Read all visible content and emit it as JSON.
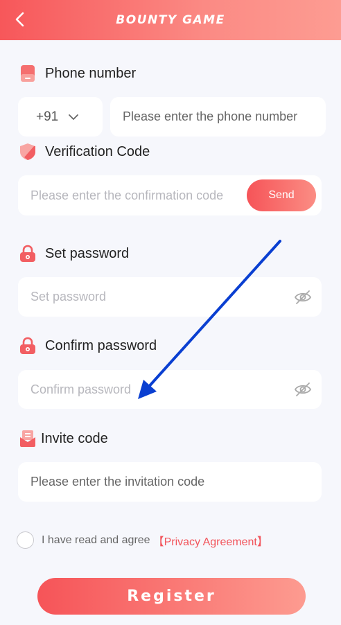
{
  "header": {
    "title": "BOUNTY GAME"
  },
  "phone": {
    "label": "Phone number",
    "country_code": "+91",
    "placeholder": "Please enter the phone number"
  },
  "verification": {
    "label": "Verification Code",
    "placeholder": "Please enter the confirmation code",
    "send_label": "Send"
  },
  "password": {
    "label": "Set password",
    "placeholder": "Set password"
  },
  "confirm": {
    "label": "Confirm password",
    "placeholder": "Confirm password"
  },
  "invite": {
    "label": "Invite code",
    "placeholder": "Please enter the invitation code"
  },
  "agreement": {
    "text": "I have read and agree",
    "link": "【Privacy Agreement】"
  },
  "register_label": "Register",
  "colors": {
    "accent": "#f65458",
    "accent_light": "#fd9b90",
    "annotation_arrow": "#0a3fd1"
  }
}
